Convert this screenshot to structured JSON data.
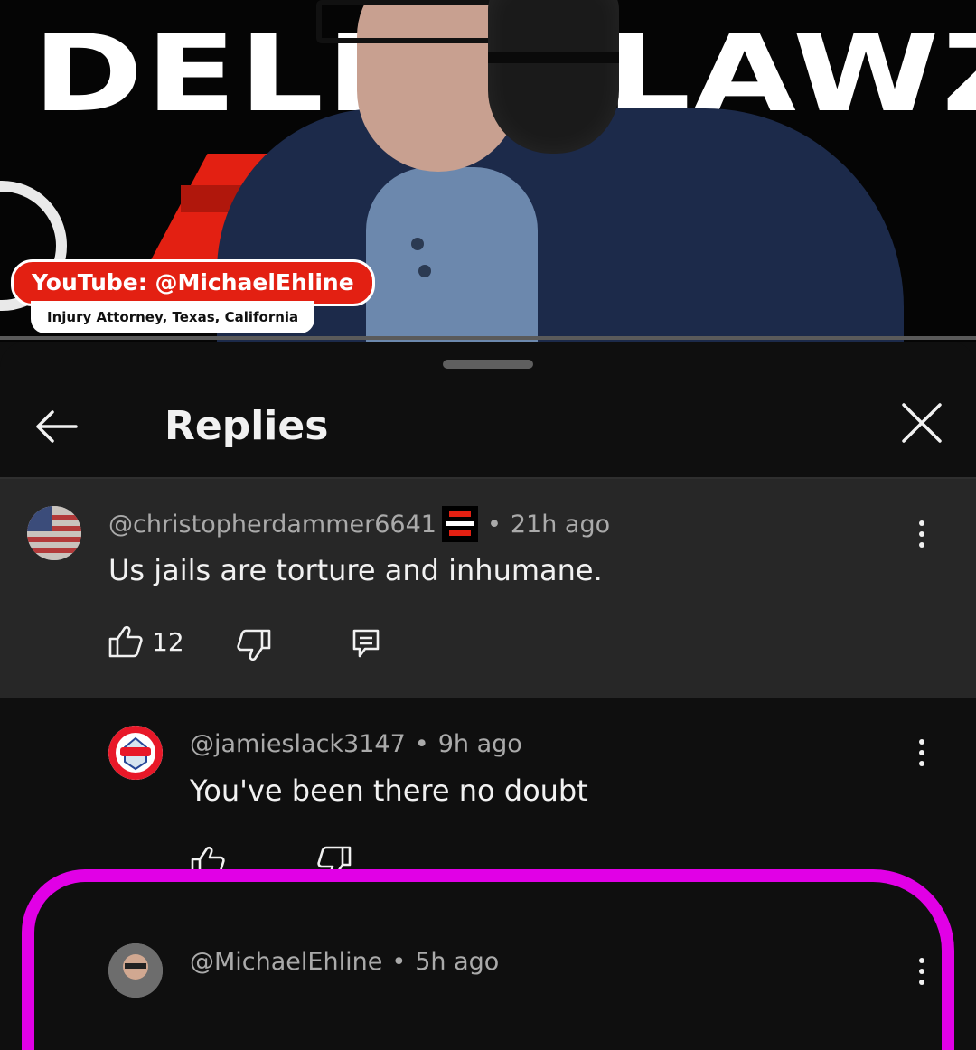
{
  "video": {
    "brand_text": "DELETELAWZ",
    "channel_tag": "YouTube: @MichaelEhline",
    "channel_subtag": "Injury Attorney, Texas, California"
  },
  "panel": {
    "title": "Replies",
    "back_icon": "arrow-left-icon",
    "close_icon": "close-icon"
  },
  "comments": [
    {
      "author": "@christopherdammer6641",
      "badge": "DELETELAWZ",
      "separator": "•",
      "time": "21h ago",
      "text": "Us jails are torture and inhumane.",
      "likes": "12"
    },
    {
      "author": "@jamieslack3147",
      "separator": "•",
      "time": "9h ago",
      "text": "You've been there no doubt",
      "likes": ""
    },
    {
      "author": "@MichaelEhline",
      "separator": "•",
      "time": "5h ago"
    }
  ],
  "colors": {
    "background": "#0f0f0f",
    "pinned_background": "#272727",
    "brand_red": "#e32012",
    "highlight": "#e100e6",
    "meta_text": "#aaaaaa"
  }
}
